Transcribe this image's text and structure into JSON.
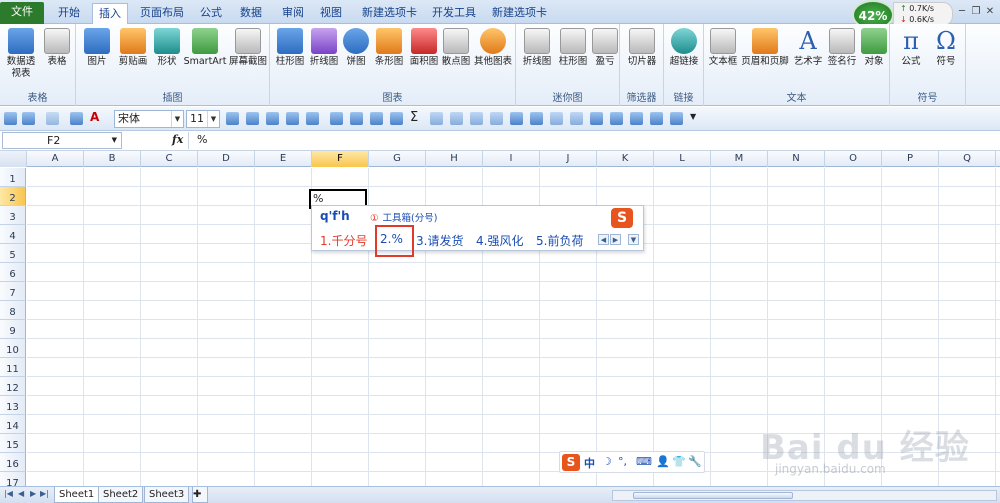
{
  "tabs": [
    {
      "label": "文件",
      "x": 0
    },
    {
      "label": "开始",
      "x": 0
    },
    {
      "label": "插入",
      "x": 0
    },
    {
      "label": "页面布局",
      "x": 0
    },
    {
      "label": "公式",
      "x": 0
    },
    {
      "label": "数据",
      "x": 0
    },
    {
      "label": "审阅",
      "x": 0
    },
    {
      "label": "视图",
      "x": 0
    },
    {
      "label": "新建选项卡",
      "x": 0
    },
    {
      "label": "开发工具",
      "x": 0
    },
    {
      "label": "新建选项卡",
      "x": 0
    }
  ],
  "net": {
    "percent": "42%",
    "up": "0.7K/s",
    "down": "0.6K/s"
  },
  "ribbon": {
    "groups": [
      {
        "label": "表格",
        "buttons": [
          "数据透视表",
          "表格"
        ]
      },
      {
        "label": "插图",
        "buttons": [
          "图片",
          "剪贴画",
          "形状",
          "SmartArt",
          "屏幕截图"
        ]
      },
      {
        "label": "图表",
        "buttons": [
          "柱形图",
          "折线图",
          "饼图",
          "条形图",
          "面积图",
          "散点图",
          "其他图表"
        ]
      },
      {
        "label": "迷你图",
        "buttons": [
          "折线图",
          "柱形图",
          "盈亏"
        ]
      },
      {
        "label": "筛选器",
        "buttons": [
          "切片器"
        ]
      },
      {
        "label": "链接",
        "buttons": [
          "超链接"
        ]
      },
      {
        "label": "文本",
        "buttons": [
          "文本框",
          "页眉和页脚",
          "艺术字",
          "签名行",
          "对象"
        ]
      },
      {
        "label": "符号",
        "buttons": [
          "公式",
          "符号"
        ]
      }
    ]
  },
  "qat": {
    "font": "宋体",
    "size": "11"
  },
  "formula": {
    "namebox": "F2",
    "fx": "fx",
    "content": "%"
  },
  "columns": [
    "A",
    "B",
    "C",
    "D",
    "E",
    "F",
    "G",
    "H",
    "I",
    "J",
    "K",
    "L",
    "M",
    "N",
    "O",
    "P",
    "Q"
  ],
  "rows": [
    "1",
    "2",
    "3",
    "4",
    "5",
    "6",
    "7",
    "8",
    "9",
    "10",
    "11",
    "12",
    "13",
    "14",
    "15",
    "16",
    "17"
  ],
  "selected": {
    "col": "F",
    "row": "2"
  },
  "activecell": {
    "value": "%"
  },
  "ime": {
    "input": "q'f'h",
    "tool_warn": "①",
    "tool_label": "工具箱(分号)",
    "candidates": [
      "1.千分号",
      "2.%",
      "3.请发货",
      "4.强风化",
      "5.前负荷"
    ],
    "logo": "S"
  },
  "imebar": {
    "logo": "S",
    "mode": "中",
    "items": [
      "☽",
      "°,",
      "⌨",
      "👤",
      "👕",
      "🔧"
    ]
  },
  "sheets": [
    "Sheet1",
    "Sheet2",
    "Sheet3"
  ],
  "watermark": {
    "main": "Bai du 经验",
    "sub": "jingyan.baidu.com"
  }
}
